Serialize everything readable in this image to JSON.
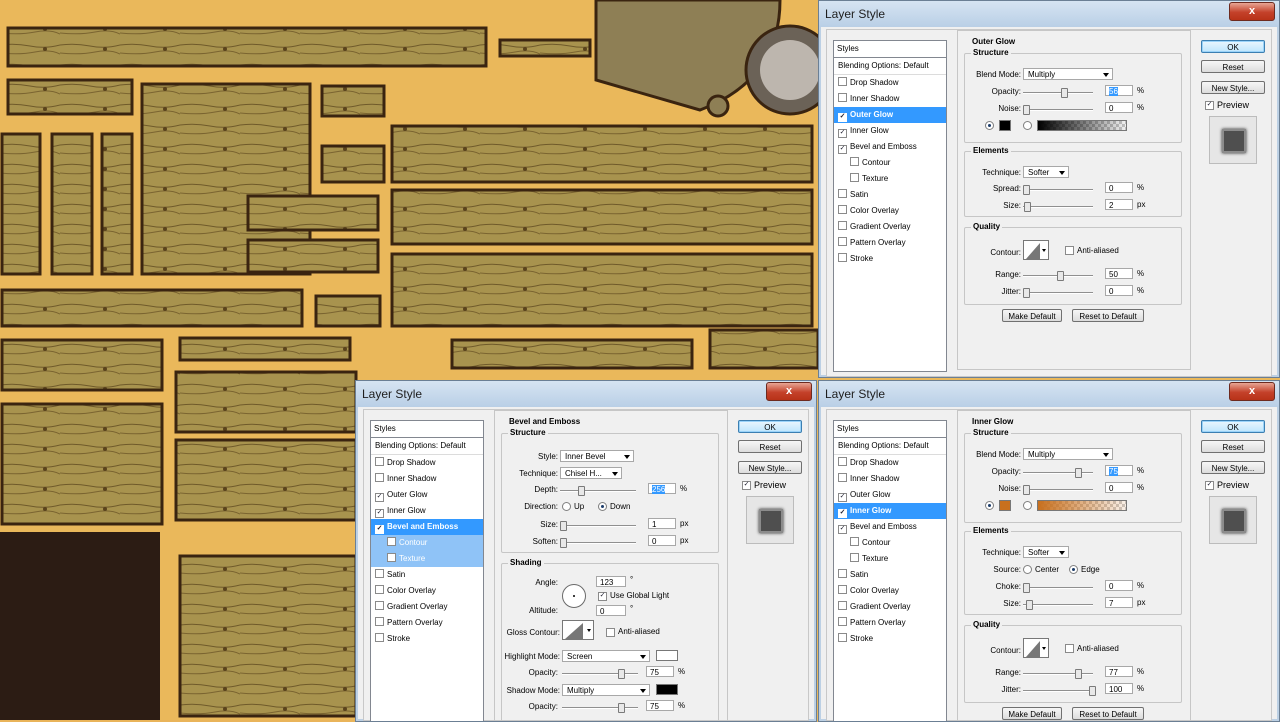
{
  "dialogs": [
    {
      "id": "outer-glow",
      "title": "Layer Style",
      "close_label": "x",
      "list": {
        "header": "Styles",
        "items": [
          {
            "label": "Blending Options: Default",
            "checkbox": false
          },
          {
            "label": "Drop Shadow",
            "checkbox": true,
            "checked": false
          },
          {
            "label": "Inner Shadow",
            "checkbox": true,
            "checked": false
          },
          {
            "label": "Outer Glow",
            "checkbox": true,
            "checked": true,
            "selected": true
          },
          {
            "label": "Inner Glow",
            "checkbox": true,
            "checked": true
          },
          {
            "label": "Bevel and Emboss",
            "checkbox": true,
            "checked": true
          },
          {
            "label": "Contour",
            "checkbox": true,
            "checked": false,
            "sub": true
          },
          {
            "label": "Texture",
            "checkbox": true,
            "checked": false,
            "sub": true
          },
          {
            "label": "Satin",
            "checkbox": true,
            "checked": false
          },
          {
            "label": "Color Overlay",
            "checkbox": true,
            "checked": false
          },
          {
            "label": "Gradient Overlay",
            "checkbox": true,
            "checked": false
          },
          {
            "label": "Pattern Overlay",
            "checkbox": true,
            "checked": false
          },
          {
            "label": "Stroke",
            "checkbox": true,
            "checked": false
          }
        ]
      },
      "panel": {
        "title": "Outer Glow",
        "structure": {
          "title": "Structure",
          "blend_mode_label": "Blend Mode:",
          "blend_mode": "Multiply",
          "opacity_label": "Opacity:",
          "opacity": "56",
          "opacity_unit": "%",
          "noise_label": "Noise:",
          "noise": "0",
          "noise_unit": "%"
        },
        "elements": {
          "title": "Elements",
          "technique_label": "Technique:",
          "technique": "Softer",
          "spread_label": "Spread:",
          "spread": "0",
          "spread_unit": "%",
          "size_label": "Size:",
          "size": "2",
          "size_unit": "px"
        },
        "quality": {
          "title": "Quality",
          "contour_label": "Contour:",
          "antialiased_label": "Anti-aliased",
          "range_label": "Range:",
          "range": "50",
          "range_unit": "%",
          "jitter_label": "Jitter:",
          "jitter": "0",
          "jitter_unit": "%"
        },
        "make_default": "Make Default",
        "reset_default": "Reset to Default"
      },
      "buttons": {
        "ok": "OK",
        "reset": "Reset",
        "new_style": "New Style...",
        "preview": "Preview"
      },
      "colors": {
        "swatch": "#000000",
        "gradient_from": "#000000"
      }
    },
    {
      "id": "bevel-emboss",
      "title": "Layer Style",
      "close_label": "x",
      "list": {
        "header": "Styles",
        "items": [
          {
            "label": "Blending Options: Default",
            "checkbox": false
          },
          {
            "label": "Drop Shadow",
            "checkbox": true,
            "checked": false
          },
          {
            "label": "Inner Shadow",
            "checkbox": true,
            "checked": false
          },
          {
            "label": "Outer Glow",
            "checkbox": true,
            "checked": true
          },
          {
            "label": "Inner Glow",
            "checkbox": true,
            "checked": true
          },
          {
            "label": "Bevel and Emboss",
            "checkbox": true,
            "checked": true,
            "selected": true
          },
          {
            "label": "Contour",
            "checkbox": true,
            "checked": false,
            "sub": true,
            "subsel": true
          },
          {
            "label": "Texture",
            "checkbox": true,
            "checked": false,
            "sub": true,
            "subsel": true
          },
          {
            "label": "Satin",
            "checkbox": true,
            "checked": false
          },
          {
            "label": "Color Overlay",
            "checkbox": true,
            "checked": false
          },
          {
            "label": "Gradient Overlay",
            "checkbox": true,
            "checked": false
          },
          {
            "label": "Pattern Overlay",
            "checkbox": true,
            "checked": false
          },
          {
            "label": "Stroke",
            "checkbox": true,
            "checked": false
          }
        ]
      },
      "panel": {
        "title": "Bevel and Emboss",
        "structure": {
          "title": "Structure",
          "style_label": "Style:",
          "style": "Inner Bevel",
          "technique_label": "Technique:",
          "technique": "Chisel H...",
          "depth_label": "Depth:",
          "depth": "256",
          "depth_unit": "%",
          "direction_label": "Direction:",
          "up_label": "Up",
          "down_label": "Down",
          "size_label": "Size:",
          "size": "1",
          "size_unit": "px",
          "soften_label": "Soften:",
          "soften": "0",
          "soften_unit": "px"
        },
        "shading": {
          "title": "Shading",
          "angle_label": "Angle:",
          "angle": "123",
          "angle_unit": "°",
          "global_light_label": "Use Global Light",
          "altitude_label": "Altitude:",
          "altitude": "0",
          "altitude_unit": "°",
          "gloss_label": "Gloss Contour:",
          "antialiased_label": "Anti-aliased",
          "highlight_label": "Highlight Mode:",
          "highlight_mode": "Screen",
          "highlight_opacity_label": "Opacity:",
          "highlight_opacity": "75",
          "highlight_unit": "%",
          "shadow_label": "Shadow Mode:",
          "shadow_mode": "Multiply",
          "shadow_opacity_label": "Opacity:",
          "shadow_opacity": "75",
          "shadow_unit": "%"
        }
      },
      "buttons": {
        "ok": "OK",
        "reset": "Reset",
        "new_style": "New Style...",
        "preview": "Preview"
      },
      "colors": {
        "highlight": "#ffffff",
        "shadow": "#000000"
      }
    },
    {
      "id": "inner-glow",
      "title": "Layer Style",
      "close_label": "x",
      "list": {
        "header": "Styles",
        "items": [
          {
            "label": "Blending Options: Default",
            "checkbox": false
          },
          {
            "label": "Drop Shadow",
            "checkbox": true,
            "checked": false
          },
          {
            "label": "Inner Shadow",
            "checkbox": true,
            "checked": false
          },
          {
            "label": "Outer Glow",
            "checkbox": true,
            "checked": true
          },
          {
            "label": "Inner Glow",
            "checkbox": true,
            "checked": true,
            "selected": true
          },
          {
            "label": "Bevel and Emboss",
            "checkbox": true,
            "checked": true
          },
          {
            "label": "Contour",
            "checkbox": true,
            "checked": false,
            "sub": true
          },
          {
            "label": "Texture",
            "checkbox": true,
            "checked": false,
            "sub": true
          },
          {
            "label": "Satin",
            "checkbox": true,
            "checked": false
          },
          {
            "label": "Color Overlay",
            "checkbox": true,
            "checked": false
          },
          {
            "label": "Gradient Overlay",
            "checkbox": true,
            "checked": false
          },
          {
            "label": "Pattern Overlay",
            "checkbox": true,
            "checked": false
          },
          {
            "label": "Stroke",
            "checkbox": true,
            "checked": false
          }
        ]
      },
      "panel": {
        "title": "Inner Glow",
        "structure": {
          "title": "Structure",
          "blend_mode_label": "Blend Mode:",
          "blend_mode": "Multiply",
          "opacity_label": "Opacity:",
          "opacity": "75",
          "opacity_unit": "%",
          "noise_label": "Noise:",
          "noise": "0",
          "noise_unit": "%"
        },
        "elements": {
          "title": "Elements",
          "technique_label": "Technique:",
          "technique": "Softer",
          "source_label": "Source:",
          "center_label": "Center",
          "edge_label": "Edge",
          "choke_label": "Choke:",
          "choke": "0",
          "choke_unit": "%",
          "size_label": "Size:",
          "size": "7",
          "size_unit": "px"
        },
        "quality": {
          "title": "Quality",
          "contour_label": "Contour:",
          "antialiased_label": "Anti-aliased",
          "range_label": "Range:",
          "range": "77",
          "range_unit": "%",
          "jitter_label": "Jitter:",
          "jitter": "100",
          "jitter_unit": "%"
        },
        "make_default": "Make Default",
        "reset_default": "Reset to Default"
      },
      "buttons": {
        "ok": "OK",
        "reset": "Reset",
        "new_style": "New Style...",
        "preview": "Preview"
      },
      "colors": {
        "swatch": "#c8701e",
        "gradient_from": "#c8701e"
      }
    }
  ]
}
